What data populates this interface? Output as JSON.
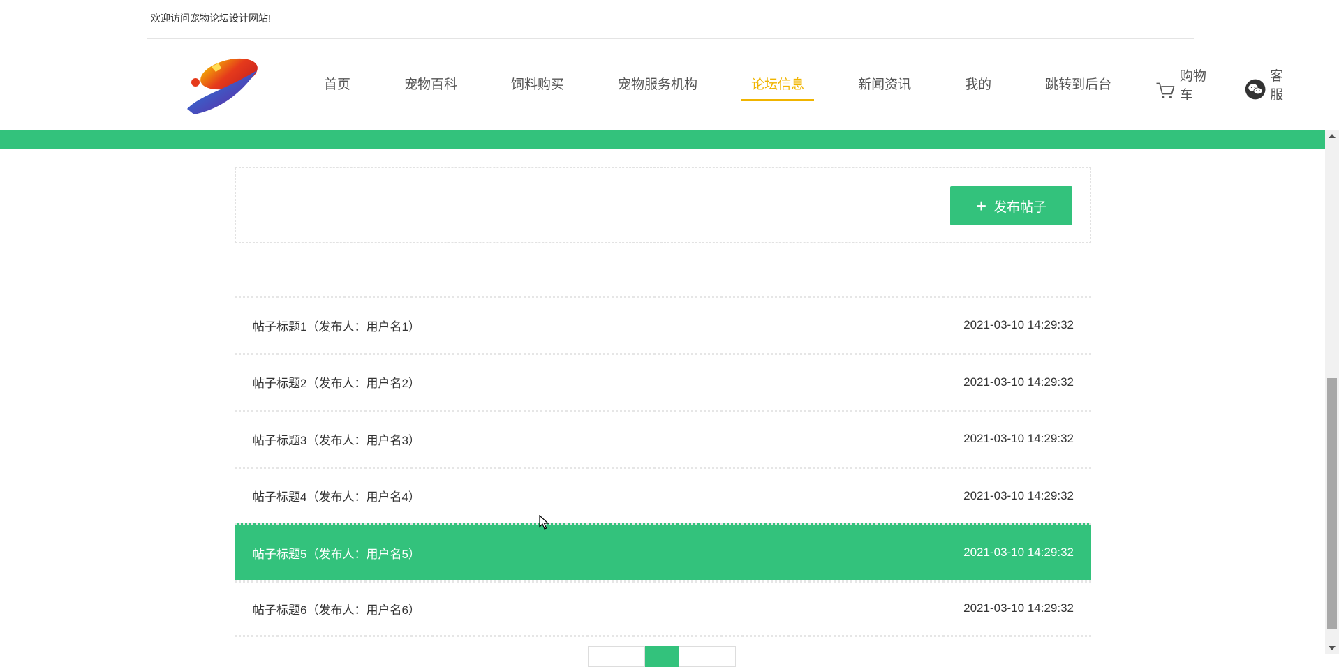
{
  "topbar": {
    "welcome": "欢迎访问宠物论坛设计网站!"
  },
  "nav": {
    "items": [
      "首页",
      "宠物百科",
      "饲料购买",
      "宠物服务机构",
      "论坛信息",
      "新闻资讯",
      "我的",
      "跳转到后台"
    ],
    "active_index": 4,
    "cart_label": "购物车",
    "service_label": "客服"
  },
  "colors": {
    "accent": "#33c27c",
    "active_nav": "#f0b400"
  },
  "forum": {
    "publish_button": "发布帖子",
    "posts": [
      {
        "title": "帖子标题1（发布人：用户名1）",
        "time": "2021-03-10 14:29:32"
      },
      {
        "title": "帖子标题2（发布人：用户名2）",
        "time": "2021-03-10 14:29:32"
      },
      {
        "title": "帖子标题3（发布人：用户名3）",
        "time": "2021-03-10 14:29:32"
      },
      {
        "title": "帖子标题4（发布人：用户名4）",
        "time": "2021-03-10 14:29:32"
      },
      {
        "title": "帖子标题5（发布人：用户名5）",
        "time": "2021-03-10 14:29:32"
      },
      {
        "title": "帖子标题6（发布人：用户名6）",
        "time": "2021-03-10 14:29:32"
      }
    ],
    "highlighted_index": 4
  },
  "icons": [
    "logo",
    "cart-icon",
    "wechat-icon",
    "plus-icon",
    "cursor-icon"
  ]
}
